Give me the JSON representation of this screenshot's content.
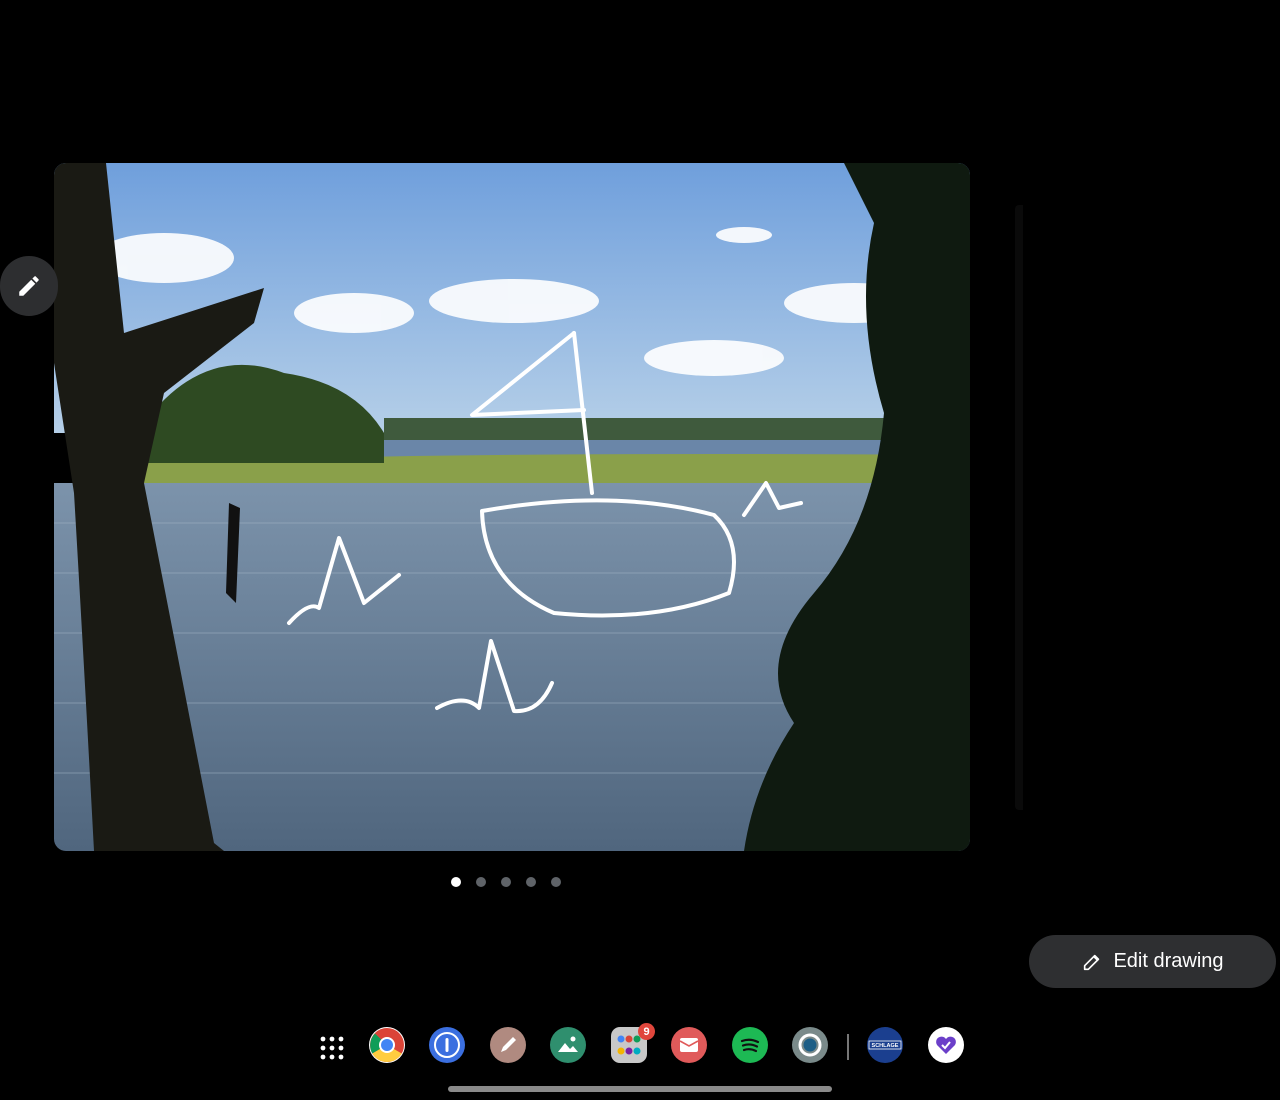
{
  "viewer": {
    "page_count": 5,
    "active_page": 1
  },
  "edit_drawing": {
    "label": "Edit drawing",
    "icon": "pencil-icon"
  },
  "floating_button": {
    "icon": "pencil-icon"
  },
  "shelf": {
    "launcher_icon": "app-launcher-icon",
    "apps": [
      {
        "name": "Chrome",
        "icon": "chrome-icon",
        "color": "#ffffff"
      },
      {
        "name": "1Password",
        "icon": "1password-icon",
        "color": "#3b6fe0"
      },
      {
        "name": "Draw",
        "icon": "draw-pencil-icon",
        "color": "#b08a80"
      },
      {
        "name": "Gallery",
        "icon": "gallery-icon",
        "color": "#2f8f6e"
      },
      {
        "name": "Apps Folder",
        "icon": "app-folder-icon",
        "color": "#c8c8c8",
        "badge": "9"
      },
      {
        "name": "Mail",
        "icon": "mail-icon",
        "color": "#e05a5a"
      },
      {
        "name": "Spotify",
        "icon": "spotify-icon",
        "color": "#1db954"
      },
      {
        "name": "Alexa",
        "icon": "alexa-icon",
        "color": "#7a8a8a"
      },
      {
        "name": "Schlage",
        "icon": "schlage-icon",
        "color": "#1b3f8f",
        "text": "SCHLAGE"
      },
      {
        "name": "Heart App",
        "icon": "heart-check-icon",
        "color": "#ffffff"
      }
    ]
  },
  "colors": {
    "background": "#000000",
    "button": "#2e2f31",
    "accent_dot": "#ffffff"
  }
}
